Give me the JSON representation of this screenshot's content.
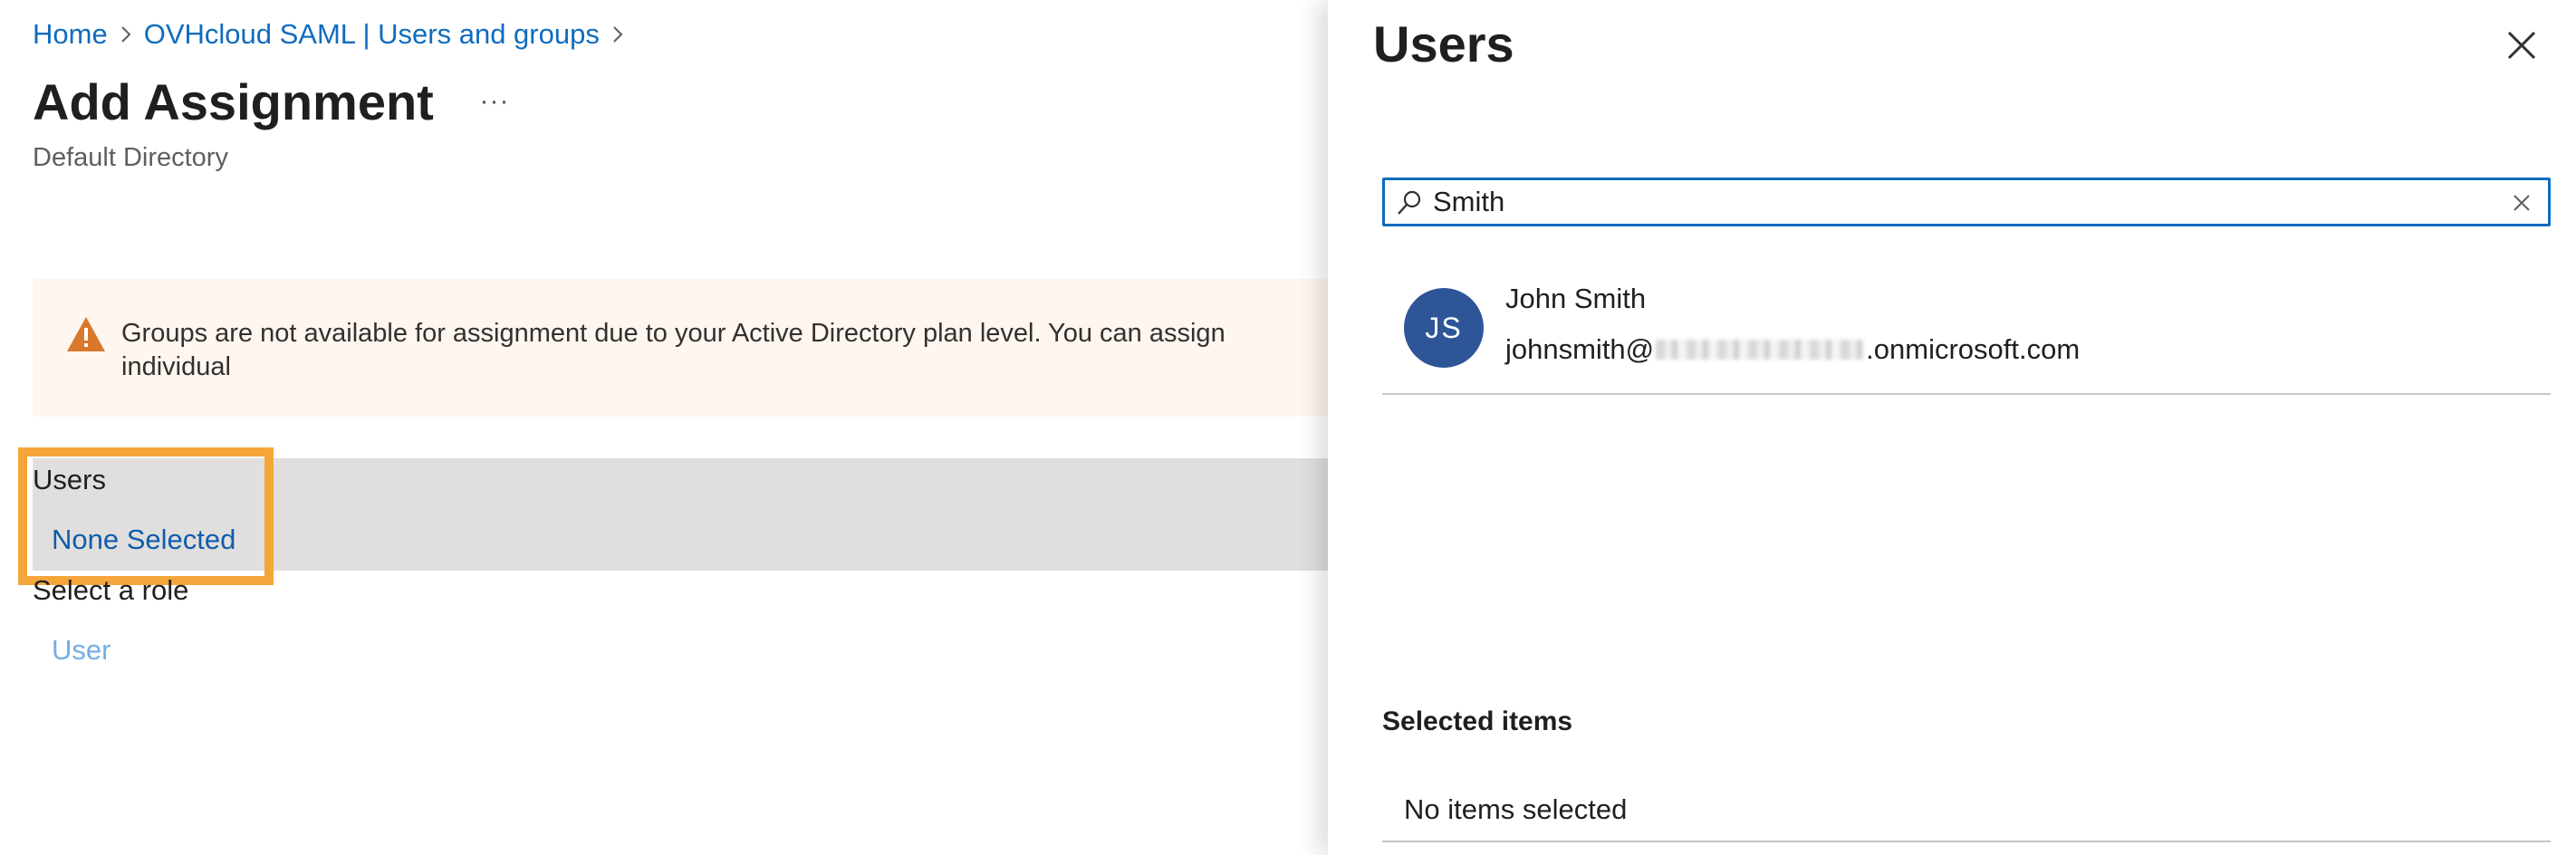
{
  "breadcrumb": {
    "items": [
      {
        "label": "Home"
      },
      {
        "label": "OVHcloud SAML | Users and groups"
      }
    ],
    "separator_icon": "chevron-right-icon"
  },
  "page": {
    "title": "Add Assignment",
    "more_label": "···",
    "subtitle": "Default Directory"
  },
  "warning": {
    "icon": "warning-triangle-icon",
    "text": "Groups are not available for assignment due to your Active Directory plan level. You can assign individual\nthe application."
  },
  "assignment": {
    "users_label": "Users",
    "users_value": "None Selected",
    "role_label": "Select a role",
    "role_value": "User"
  },
  "panel": {
    "title": "Users",
    "close_icon": "close-icon",
    "search": {
      "value": "Smith",
      "placeholder": "",
      "icon": "search-icon",
      "clear_icon": "clear-icon"
    },
    "results": [
      {
        "initials": "JS",
        "name": "John Smith",
        "email_prefix": "johnsmith@",
        "email_suffix": ".onmicrosoft.com"
      }
    ],
    "selected_title": "Selected items",
    "selected_empty": "No items selected"
  },
  "colors": {
    "link": "#0f6cbd",
    "highlight": "#f5a63a",
    "warning_bg": "#fff6ef",
    "warning_icon": "#d9782d",
    "avatar_bg": "#2e5597",
    "band_bg": "#e1dfdd"
  }
}
